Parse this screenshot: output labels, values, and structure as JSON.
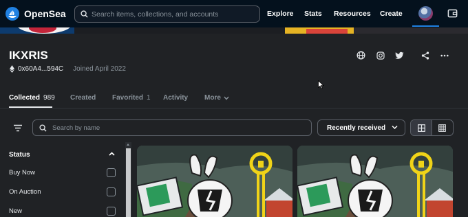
{
  "nav": {
    "brand": "OpenSea",
    "search_placeholder": "Search items, collections, and accounts",
    "links": [
      "Explore",
      "Stats",
      "Resources",
      "Create"
    ],
    "brand_color": "#2081e2"
  },
  "profile": {
    "name": "IKXRIS",
    "address": "0x60A4...594C",
    "joined": "Joined April 2022"
  },
  "tabs": [
    {
      "label": "Collected",
      "count": "989"
    },
    {
      "label": "Created",
      "count": ""
    },
    {
      "label": "Favorited",
      "count": "1"
    },
    {
      "label": "Activity",
      "count": ""
    },
    {
      "label": "More",
      "count": ""
    }
  ],
  "toolbar": {
    "search_placeholder": "Search by name",
    "sort_value": "Recently received"
  },
  "sidebar": {
    "status_title": "Status",
    "options": [
      "Buy Now",
      "On Auction",
      "New"
    ]
  },
  "icons": {
    "search": "search-icon",
    "wallet": "wallet-icon",
    "globe": "globe-icon",
    "instagram": "instagram-icon",
    "twitter": "twitter-icon",
    "share": "share-icon",
    "more": "more-icon",
    "filter": "filter-icon"
  }
}
